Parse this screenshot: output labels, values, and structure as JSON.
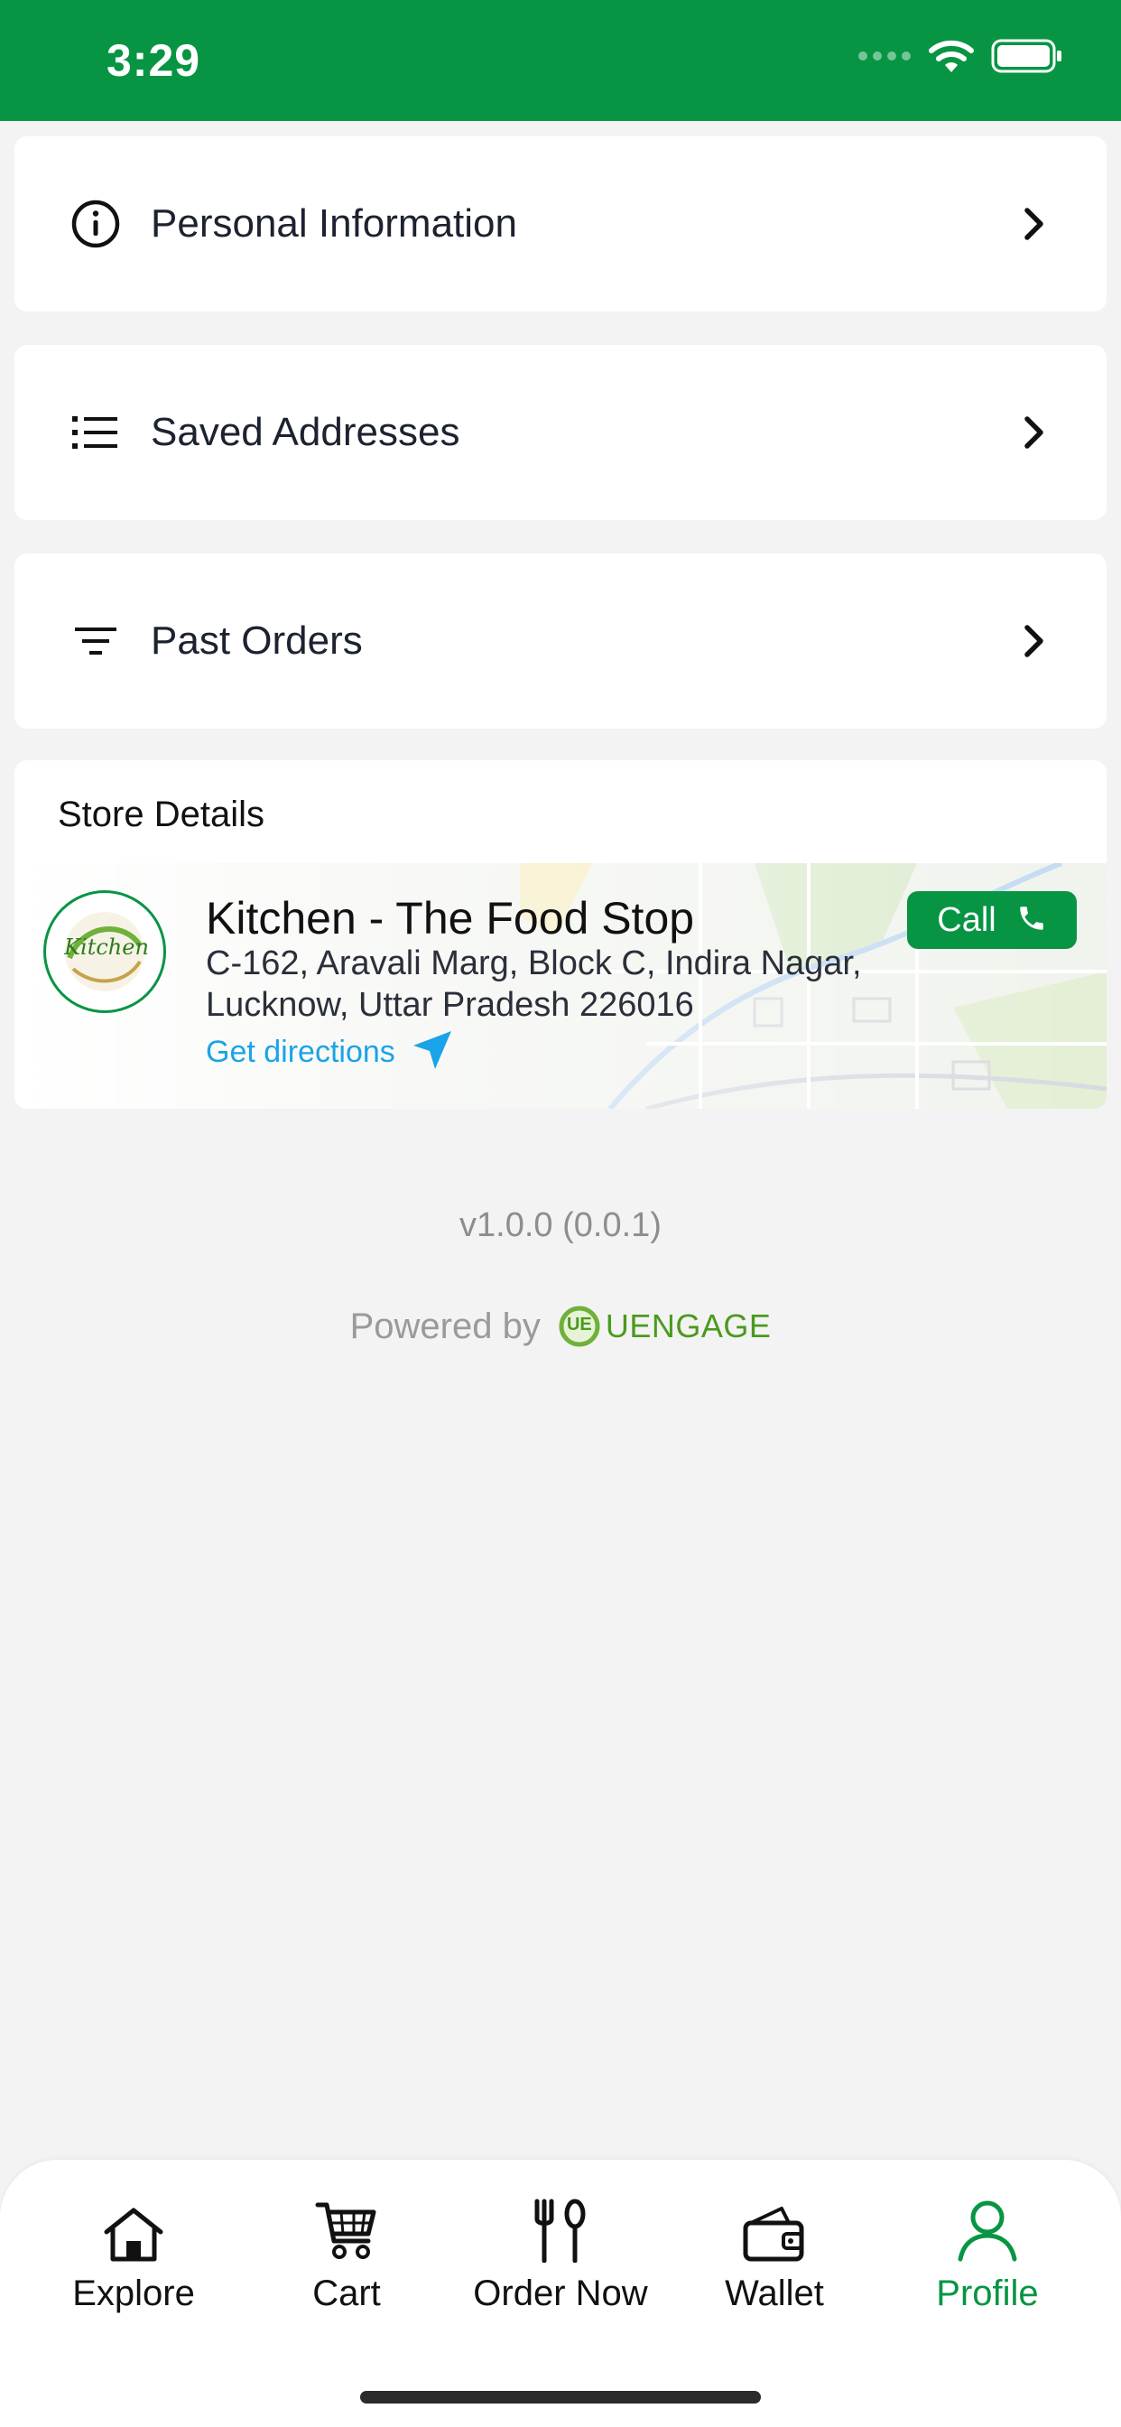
{
  "status_bar": {
    "time": "3:29",
    "icons": [
      "signal-icon",
      "wifi-icon",
      "battery-icon"
    ]
  },
  "menu": [
    {
      "label": "Personal Information",
      "icon": "info-icon"
    },
    {
      "label": "Saved Addresses",
      "icon": "list-icon"
    },
    {
      "label": "Past Orders",
      "icon": "filter-icon"
    }
  ],
  "store": {
    "heading": "Store Details",
    "logo_text": "Kitchen",
    "name": "Kitchen - The Food Stop",
    "address_line1": "C-162, Aravali Marg, Block C, Indira Nagar,",
    "address_line2": "Lucknow, Uttar Pradesh 226016",
    "directions_label": "Get directions",
    "call_label": "Call"
  },
  "footer": {
    "version": "v1.0.0 (0.0.1)",
    "powered_by": "Powered by",
    "brand_logo_text": "UE",
    "brand_name": "UENGAGE"
  },
  "tabs": [
    {
      "label": "Explore",
      "icon": "home-icon",
      "active": false
    },
    {
      "label": "Cart",
      "icon": "cart-icon",
      "active": false
    },
    {
      "label": "Order Now",
      "icon": "fork-spoon-icon",
      "active": false
    },
    {
      "label": "Wallet",
      "icon": "wallet-icon",
      "active": false
    },
    {
      "label": "Profile",
      "icon": "user-icon",
      "active": true
    }
  ],
  "colors": {
    "brand_green": "#079544",
    "link_blue": "#1aa3e8",
    "background": "#f3f3f3"
  }
}
